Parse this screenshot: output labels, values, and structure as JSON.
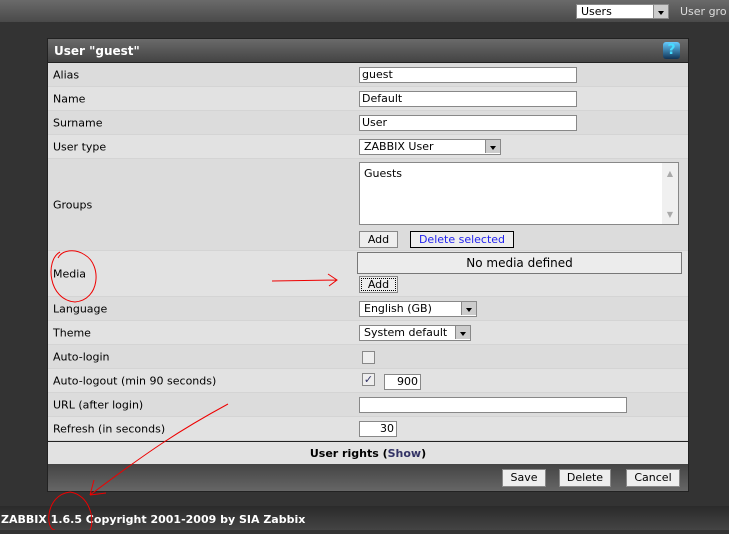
{
  "topbar": {
    "select_value": "Users",
    "label": "User gro"
  },
  "form": {
    "title": "User \"guest\"",
    "rows": {
      "alias": {
        "label": "Alias",
        "value": "guest"
      },
      "name": {
        "label": "Name",
        "value": "Default"
      },
      "surname": {
        "label": "Surname",
        "value": "User"
      },
      "user_type": {
        "label": "User type",
        "value": "ZABBIX User"
      },
      "groups": {
        "label": "Groups",
        "items": [
          "Guests"
        ],
        "add": "Add",
        "delete_selected": "Delete selected"
      },
      "media": {
        "label": "Media",
        "empty": "No media defined",
        "add": "Add"
      },
      "language": {
        "label": "Language",
        "value": "English (GB)"
      },
      "theme": {
        "label": "Theme",
        "value": "System default"
      },
      "autologin": {
        "label": "Auto-login",
        "checked": false
      },
      "autologout": {
        "label": "Auto-logout (min 90 seconds)",
        "checked": true,
        "value": "900"
      },
      "url": {
        "label": "URL (after login)",
        "value": ""
      },
      "refresh": {
        "label": "Refresh (in seconds)",
        "value": "30"
      }
    },
    "user_rights": {
      "label": "User rights (",
      "link": "Show",
      "close": ")"
    },
    "buttons": {
      "save": "Save",
      "delete": "Delete",
      "cancel": "Cancel"
    }
  },
  "footer": {
    "text": "ZABBIX 1.6.5 Copyright 2001-2009 by  SIA Zabbix"
  }
}
